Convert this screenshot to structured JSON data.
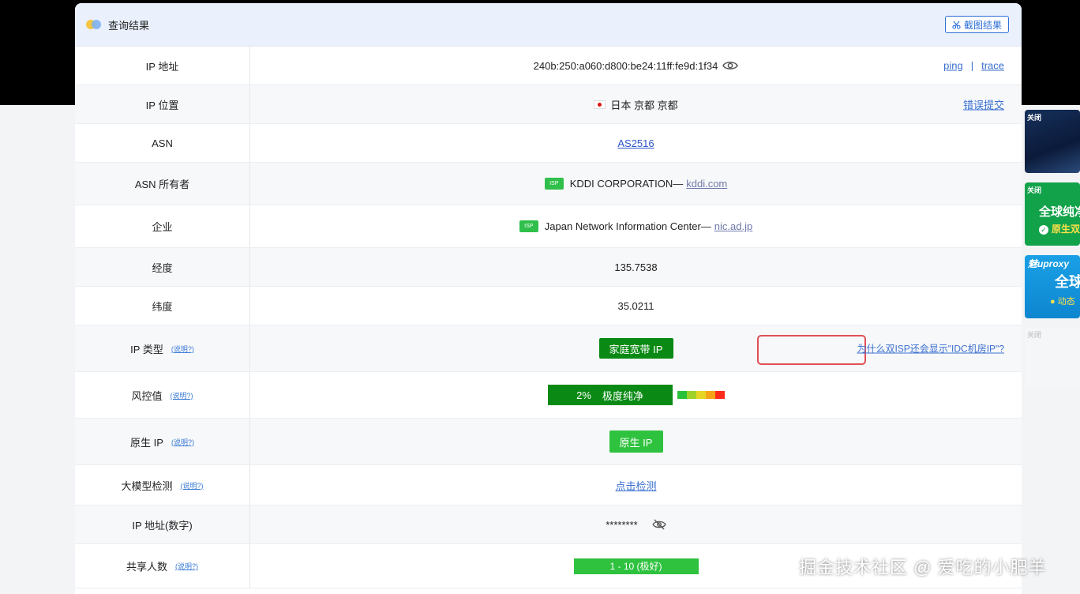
{
  "header": {
    "title": "查询结果",
    "screenshot_label": "截图结果"
  },
  "rows": {
    "ip": {
      "label": "IP 地址",
      "value": "240b:250:a060:d800:be24:11ff:fe9d:1f34",
      "ping": "ping",
      "sep": "|",
      "trace": "trace"
    },
    "location": {
      "label": "IP 位置",
      "value": "日本 京都 京都",
      "report": "错误提交"
    },
    "asn": {
      "label": "ASN",
      "value": "AS2516"
    },
    "asn_owner": {
      "label": "ASN 所有者",
      "badge": "ISP",
      "name": "KDDI CORPORATION—",
      "domain": "kddi.com"
    },
    "company": {
      "label": "企业",
      "badge": "ISP",
      "name": "Japan Network Information Center—",
      "domain": "nic.ad.jp"
    },
    "longitude": {
      "label": "经度",
      "value": "135.7538"
    },
    "latitude": {
      "label": "纬度",
      "value": "35.0211"
    },
    "ip_type": {
      "label": "IP 类型",
      "explain": "(说明?)",
      "value": "家庭宽带 IP",
      "question": "为什么双ISP还会显示\"IDC机房IP\"?"
    },
    "risk": {
      "label": "风控值",
      "explain": "(说明?)",
      "percent": "2%",
      "text": "极度纯净"
    },
    "native": {
      "label": "原生 IP",
      "explain": "(说明?)",
      "value": "原生 IP"
    },
    "llm": {
      "label": "大模型检测",
      "explain": "(说明?)",
      "value": "点击检测"
    },
    "ip_numeric": {
      "label": "IP 地址(数字)",
      "value": "********"
    },
    "shared": {
      "label": "共享人数",
      "explain": "(说明?)",
      "value": "1 - 10 (极好)"
    }
  },
  "side_ads": {
    "ad1": {
      "close": "关闭"
    },
    "ad2": {
      "close": "关闭",
      "title": "全球纯净",
      "sub": "原生双"
    },
    "ad3": {
      "brand": "魅uproxy",
      "title": "全球",
      "sub": "动态"
    },
    "ad4": {
      "close": "关闭"
    }
  },
  "colors": {
    "accent": "#2d6fd6",
    "dark_green": "#0a8a14",
    "green": "#2fc23f",
    "risk_scale": [
      "#27c23a",
      "#9ed22a",
      "#e7d524",
      "#f5a418",
      "#ff2a1a"
    ]
  },
  "watermark": "掘金技术社区 @ 爱吃的小肥羊"
}
